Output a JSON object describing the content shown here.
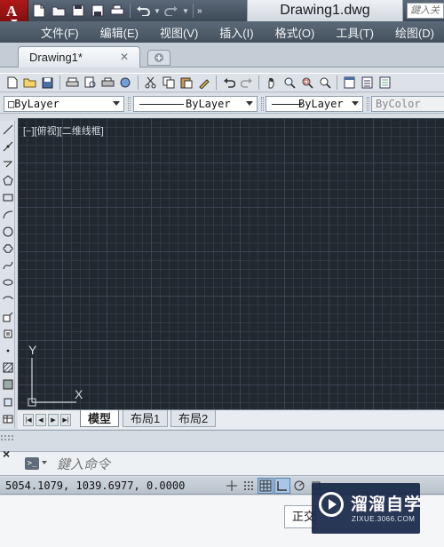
{
  "title_bar": {
    "document_title": "Drawing1.dwg",
    "search_placeholder": "鍵入关",
    "app_menu_glyph": "A",
    "qat_icons": [
      "new-icon",
      "open-icon",
      "save-icon",
      "saveas-icon",
      "print-icon",
      "undo-icon",
      "redo-icon"
    ]
  },
  "menu": {
    "items": [
      "文件(F)",
      "编辑(E)",
      "视图(V)",
      "插入(I)",
      "格式(O)",
      "工具(T)",
      "绘图(D)"
    ]
  },
  "doc_tabs": {
    "active_label": "Drawing1*"
  },
  "properties": {
    "layer": "ByLayer",
    "linetype": "ByLayer",
    "lineweight": "ByLayer",
    "color": "ByColor"
  },
  "viewport": {
    "label": "[−][俯视][二维线框]",
    "ucs_x": "X",
    "ucs_y": "Y"
  },
  "layout_tabs": {
    "items": [
      "模型",
      "布局1",
      "布局2"
    ],
    "active": "模型"
  },
  "command": {
    "close_glyph": "×",
    "placeholder": "鍵入命令"
  },
  "status": {
    "coordinates": "5054.1079, 1039.6977, 0.0000",
    "ortho_label": "正交"
  },
  "watermark": {
    "main": "溜溜自学",
    "sub": "ZIXUE.3066.COM"
  },
  "colors": {
    "canvas": "#212830",
    "app_red": "#b01818",
    "menubar": "#4e5b69"
  }
}
